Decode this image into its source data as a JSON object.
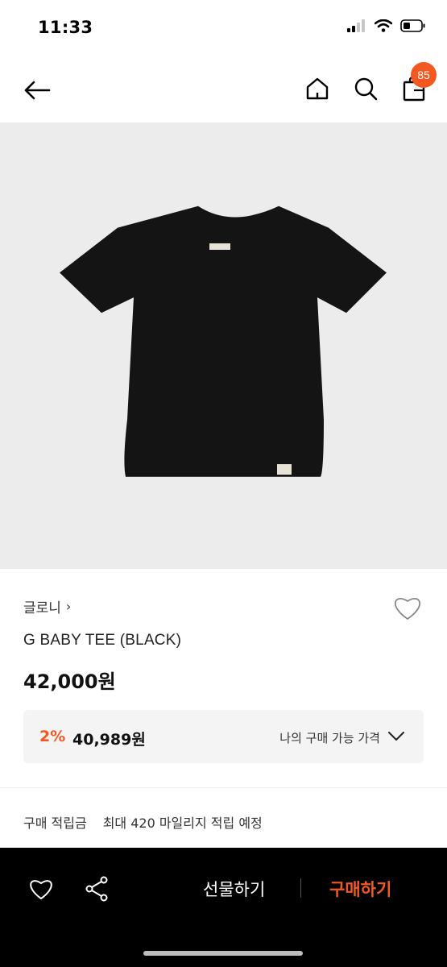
{
  "status": {
    "time": "11:33",
    "icons": [
      "cellular-signal-icon",
      "wifi-icon",
      "battery-icon"
    ]
  },
  "nav": {
    "icons": [
      "back-arrow-icon",
      "home-icon",
      "search-icon",
      "shopping-bag-icon"
    ],
    "cart_badge": "85"
  },
  "product": {
    "image": "black-t-shirt-image",
    "brand": "글로니",
    "brand_chevron": "›",
    "title": "G BABY TEE (BLACK)",
    "price": "42,000원"
  },
  "discount": {
    "rate": "2%",
    "price": "40,989원",
    "label": "나의 구매 가능 가격"
  },
  "points": {
    "label": "구매 적립금",
    "value": "최대 420 마일리지 적립 예정"
  },
  "bottom_bar": {
    "gift_label": "선물하기",
    "buy_label": "구매하기"
  },
  "colors": {
    "accent": "#f2581f",
    "image_bg": "#ececec",
    "bottom_bar": "#000000"
  }
}
